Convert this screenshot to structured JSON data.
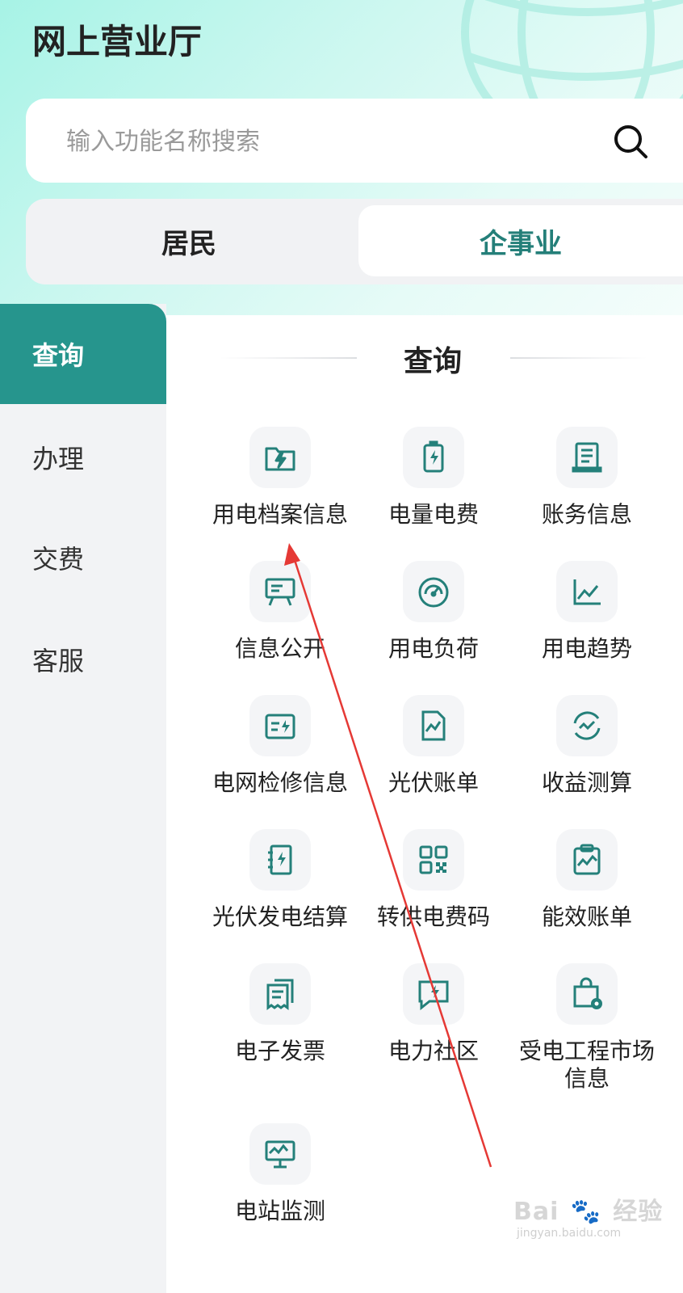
{
  "header": {
    "title": "网上营业厅"
  },
  "search": {
    "placeholder": "输入功能名称搜索",
    "value": ""
  },
  "segments": {
    "resident": "居民",
    "enterprise": "企事业",
    "selected": "企事业"
  },
  "sidebar": {
    "items": [
      {
        "label": "查询",
        "active": true
      },
      {
        "label": "办理",
        "active": false
      },
      {
        "label": "交费",
        "active": false
      },
      {
        "label": "客服",
        "active": false
      }
    ]
  },
  "section": {
    "title": "查询"
  },
  "grid": {
    "items": [
      {
        "label": "用电档案信息",
        "icon": "archive-bolt-icon"
      },
      {
        "label": "电量电费",
        "icon": "battery-icon"
      },
      {
        "label": "账务信息",
        "icon": "scroll-icon"
      },
      {
        "label": "信息公开",
        "icon": "billboard-icon"
      },
      {
        "label": "用电负荷",
        "icon": "gauge-icon"
      },
      {
        "label": "用电趋势",
        "icon": "trend-chart-icon"
      },
      {
        "label": "电网检修信息",
        "icon": "folder-bolt-icon"
      },
      {
        "label": "光伏账单",
        "icon": "pv-bill-icon"
      },
      {
        "label": "收益测算",
        "icon": "cycle-icon"
      },
      {
        "label": "光伏发电结算",
        "icon": "notebook-bolt-icon"
      },
      {
        "label": "转供电费码",
        "icon": "qr-code-icon"
      },
      {
        "label": "能效账单",
        "icon": "clipboard-chart-icon"
      },
      {
        "label": "电子发票",
        "icon": "invoice-icon"
      },
      {
        "label": "电力社区",
        "icon": "chat-bolt-icon"
      },
      {
        "label": "受电工程市场信息",
        "icon": "bag-gear-icon"
      },
      {
        "label": "电站监测",
        "icon": "monitor-icon"
      }
    ]
  },
  "watermark": {
    "logo_a": "Bai",
    "logo_b": "经验",
    "url": "jingyan.baidu.com"
  },
  "colors": {
    "accent": "#26958d",
    "accent_text": "#247f79",
    "annotation_arrow": "#e53935"
  }
}
